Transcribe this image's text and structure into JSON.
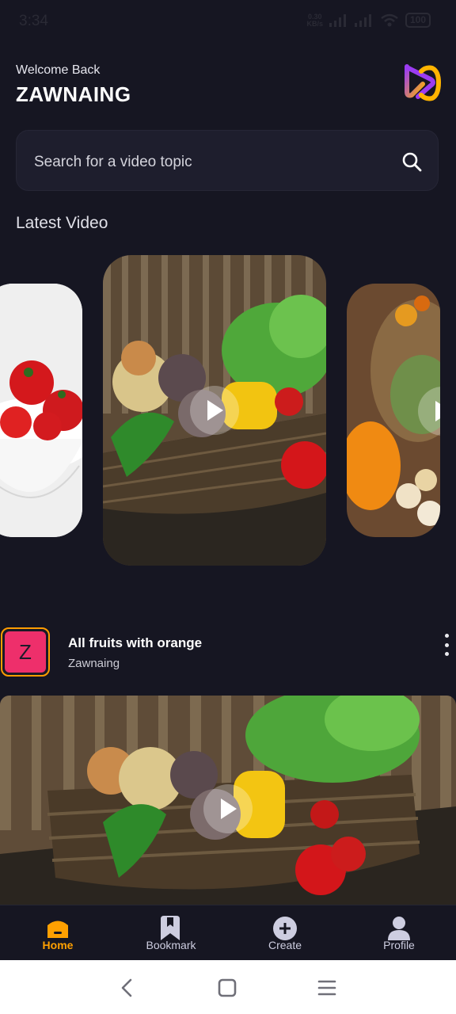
{
  "status_bar": {
    "time": "3:34",
    "net_speed_value": "0.30",
    "net_speed_unit": "KB/s",
    "battery": "100"
  },
  "header": {
    "welcome": "Welcome Back",
    "username": "ZAWNAING",
    "logo_icon": "brand-logo-icon"
  },
  "search": {
    "placeholder": "Search for a video topic",
    "value": ""
  },
  "latest": {
    "title": "Latest Video"
  },
  "post": {
    "avatar_letter": "Z",
    "title": "All fruits with orange",
    "author": "Zawnaing",
    "colors": {
      "avatar_bg": "#ee2f6b",
      "avatar_border": "#ff9c01"
    }
  },
  "tabs": [
    {
      "label": "Home",
      "icon": "home-icon",
      "active": true
    },
    {
      "label": "Bookmark",
      "icon": "bookmark-icon",
      "active": false
    },
    {
      "label": "Create",
      "icon": "plus-icon",
      "active": false
    },
    {
      "label": "Profile",
      "icon": "profile-icon",
      "active": false
    }
  ],
  "system_nav": [
    "back-icon",
    "home-square-icon",
    "menu-icon"
  ],
  "colors": {
    "background": "#161622",
    "accent": "#ffa001",
    "surface": "#1e1e2d"
  }
}
